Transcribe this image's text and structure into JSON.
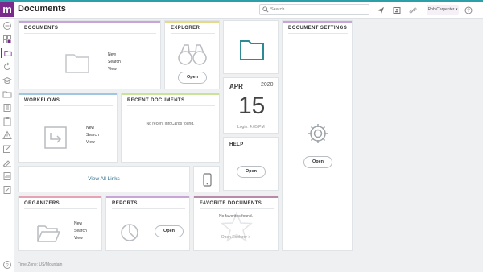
{
  "app": {
    "logo": "m",
    "title": "Documents",
    "search_placeholder": "Search",
    "user_name": "Rob Carpenter ▾",
    "footer": "Time Zone: US/Mountain"
  },
  "cards": {
    "documents": {
      "title": "DOCUMENTS",
      "links": [
        "New",
        "Search",
        "View"
      ]
    },
    "explorer": {
      "title": "EXPLORER",
      "button": "Open"
    },
    "document_settings": {
      "title": "DOCUMENT SETTINGS",
      "button": "Open"
    },
    "date": {
      "month": "APR",
      "year": "2020",
      "day": "15",
      "login": "Login: 4:05 PM"
    },
    "workflows": {
      "title": "WORKFLOWS",
      "links": [
        "New",
        "Search",
        "View"
      ]
    },
    "recent_documents": {
      "title": "RECENT DOCUMENTS",
      "empty": "No recent InfoCards found."
    },
    "help": {
      "title": "HELP",
      "button": "Open"
    },
    "all_links": {
      "label": "View All Links"
    },
    "organizers": {
      "title": "ORGANIZERS",
      "links": [
        "New",
        "Search",
        "View"
      ]
    },
    "reports": {
      "title": "REPORTS",
      "button": "Open"
    },
    "favorite_documents": {
      "title": "FAVORITE DOCUMENTS",
      "empty": "No favorites found.",
      "link": "Open Explorer >"
    }
  },
  "colors": {
    "brand": "#7a2a8d",
    "top_accent": "#2d9fa9",
    "documents_stripe": "#c9a4d6",
    "explorer_stripe": "#e6d98a",
    "settings_stripe": "#c9a4d6",
    "workflows_stripe": "#9fc7e0",
    "recent_stripe": "#c9e39a",
    "organizers_stripe": "#e7a3b5",
    "reports_stripe": "#c9a4d6",
    "favorites_stripe": "#b98aa8"
  },
  "icons": {
    "search": "search-icon",
    "send": "send-icon",
    "contact": "contact-card-icon",
    "link": "link-icon",
    "help": "help-icon",
    "folder": "folder-icon",
    "binoculars": "binoculars-icon",
    "gear": "gear-icon",
    "arrow_box": "arrow-box-icon",
    "mobile": "mobile-phone-icon",
    "open_folder": "open-folder-icon",
    "pie": "pie-chart-icon",
    "star": "star-icon"
  }
}
